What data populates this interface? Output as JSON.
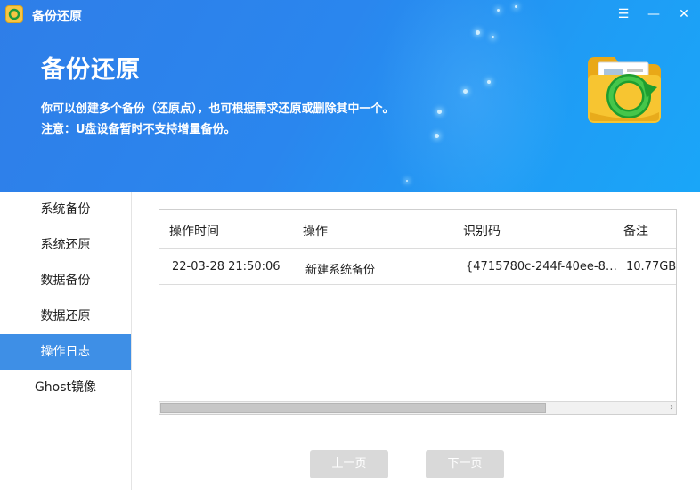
{
  "window": {
    "title": "备份还原",
    "menu_glyph": "☰",
    "minimize_glyph": "—",
    "close_glyph": "✕"
  },
  "header": {
    "title": "备份还原",
    "description": "你可以创建多个备份（还原点），也可根据需求还原或删除其中一个。",
    "notice": "注意：U盘设备暂时不支持增量备份。"
  },
  "sidebar": {
    "items": [
      {
        "label": "系统备份"
      },
      {
        "label": "系统还原"
      },
      {
        "label": "数据备份"
      },
      {
        "label": "数据还原"
      },
      {
        "label": "操作日志",
        "active": true
      },
      {
        "label": "Ghost镜像"
      }
    ]
  },
  "table": {
    "columns": [
      "操作时间",
      "操作",
      "识别码",
      "备注"
    ],
    "rows": [
      [
        "22-03-28 21:50:06",
        "新建系统备份",
        "{4715780c-244f-40ee-8…",
        "10.77GB"
      ]
    ]
  },
  "scrollbar": {
    "arrow_glyph": "›"
  },
  "pager": {
    "prev_label": "上一页",
    "next_label": "下一页"
  },
  "colors": {
    "header_gradient_start": "#2f7ee8",
    "header_gradient_end": "#1aa6f8",
    "active_tab": "#3e8fe6",
    "disabled_button": "#d9d9d9"
  }
}
